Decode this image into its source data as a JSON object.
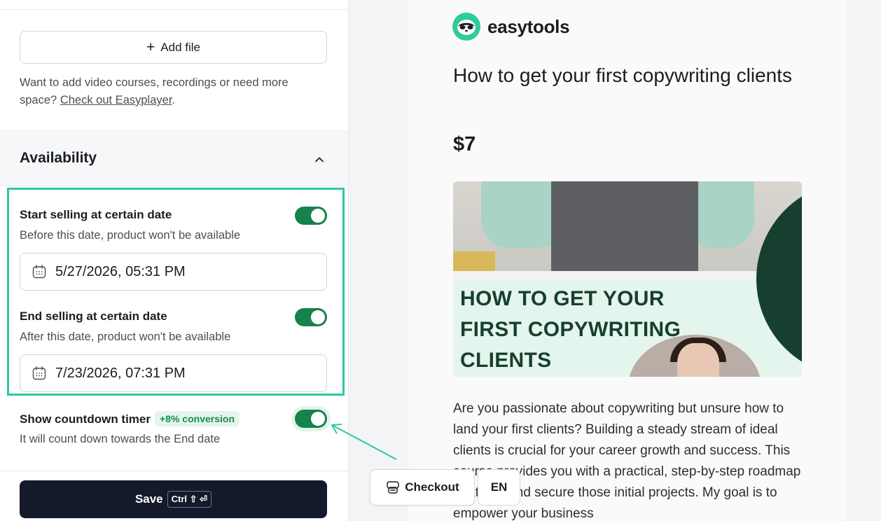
{
  "editor": {
    "add_file_label": "Add file",
    "info_text": "Want to add video courses, recordings or need more space?",
    "info_link": "Check out Easyplayer",
    "info_suffix": ".",
    "availability_title": "Availability",
    "start": {
      "title": "Start selling at certain date",
      "subtitle": "Before this date, product won't be available",
      "value": "5/27/2026, 05:31 PM",
      "enabled": true
    },
    "end": {
      "title": "End selling at certain date",
      "subtitle": "After this date, product won't be available",
      "value": "7/23/2026, 07:31 PM",
      "enabled": true
    },
    "countdown": {
      "title": "Show countdown timer",
      "badge": "+8% conversion",
      "subtitle": "It will count down towards the End date",
      "enabled": true
    },
    "save_label": "Save",
    "save_shortcut": "Ctrl ⇧ ⏎"
  },
  "preview": {
    "logo_text": "easytools",
    "product_title": "How to get your first copywriting clients",
    "price": "$7",
    "cover_text_1": "HOW TO GET YOUR",
    "cover_text_2": "FIRST COPYWRITING",
    "cover_text_3": "CLIENTS",
    "description": "Are you passionate about copywriting but unsure how to land your first clients? Building a steady stream of ideal clients is crucial for your career growth and success. This course provides you with a practical, step-by-step roadmap to attract and secure those initial projects. My goal is to empower your business",
    "checkout_label": "Checkout",
    "language": "EN"
  },
  "colors": {
    "toggle_on": "#16824c",
    "highlight": "#2ec7a1",
    "save_bg": "#141a29",
    "brand": "#2ecc9a",
    "cover_dark": "#173f2f"
  }
}
